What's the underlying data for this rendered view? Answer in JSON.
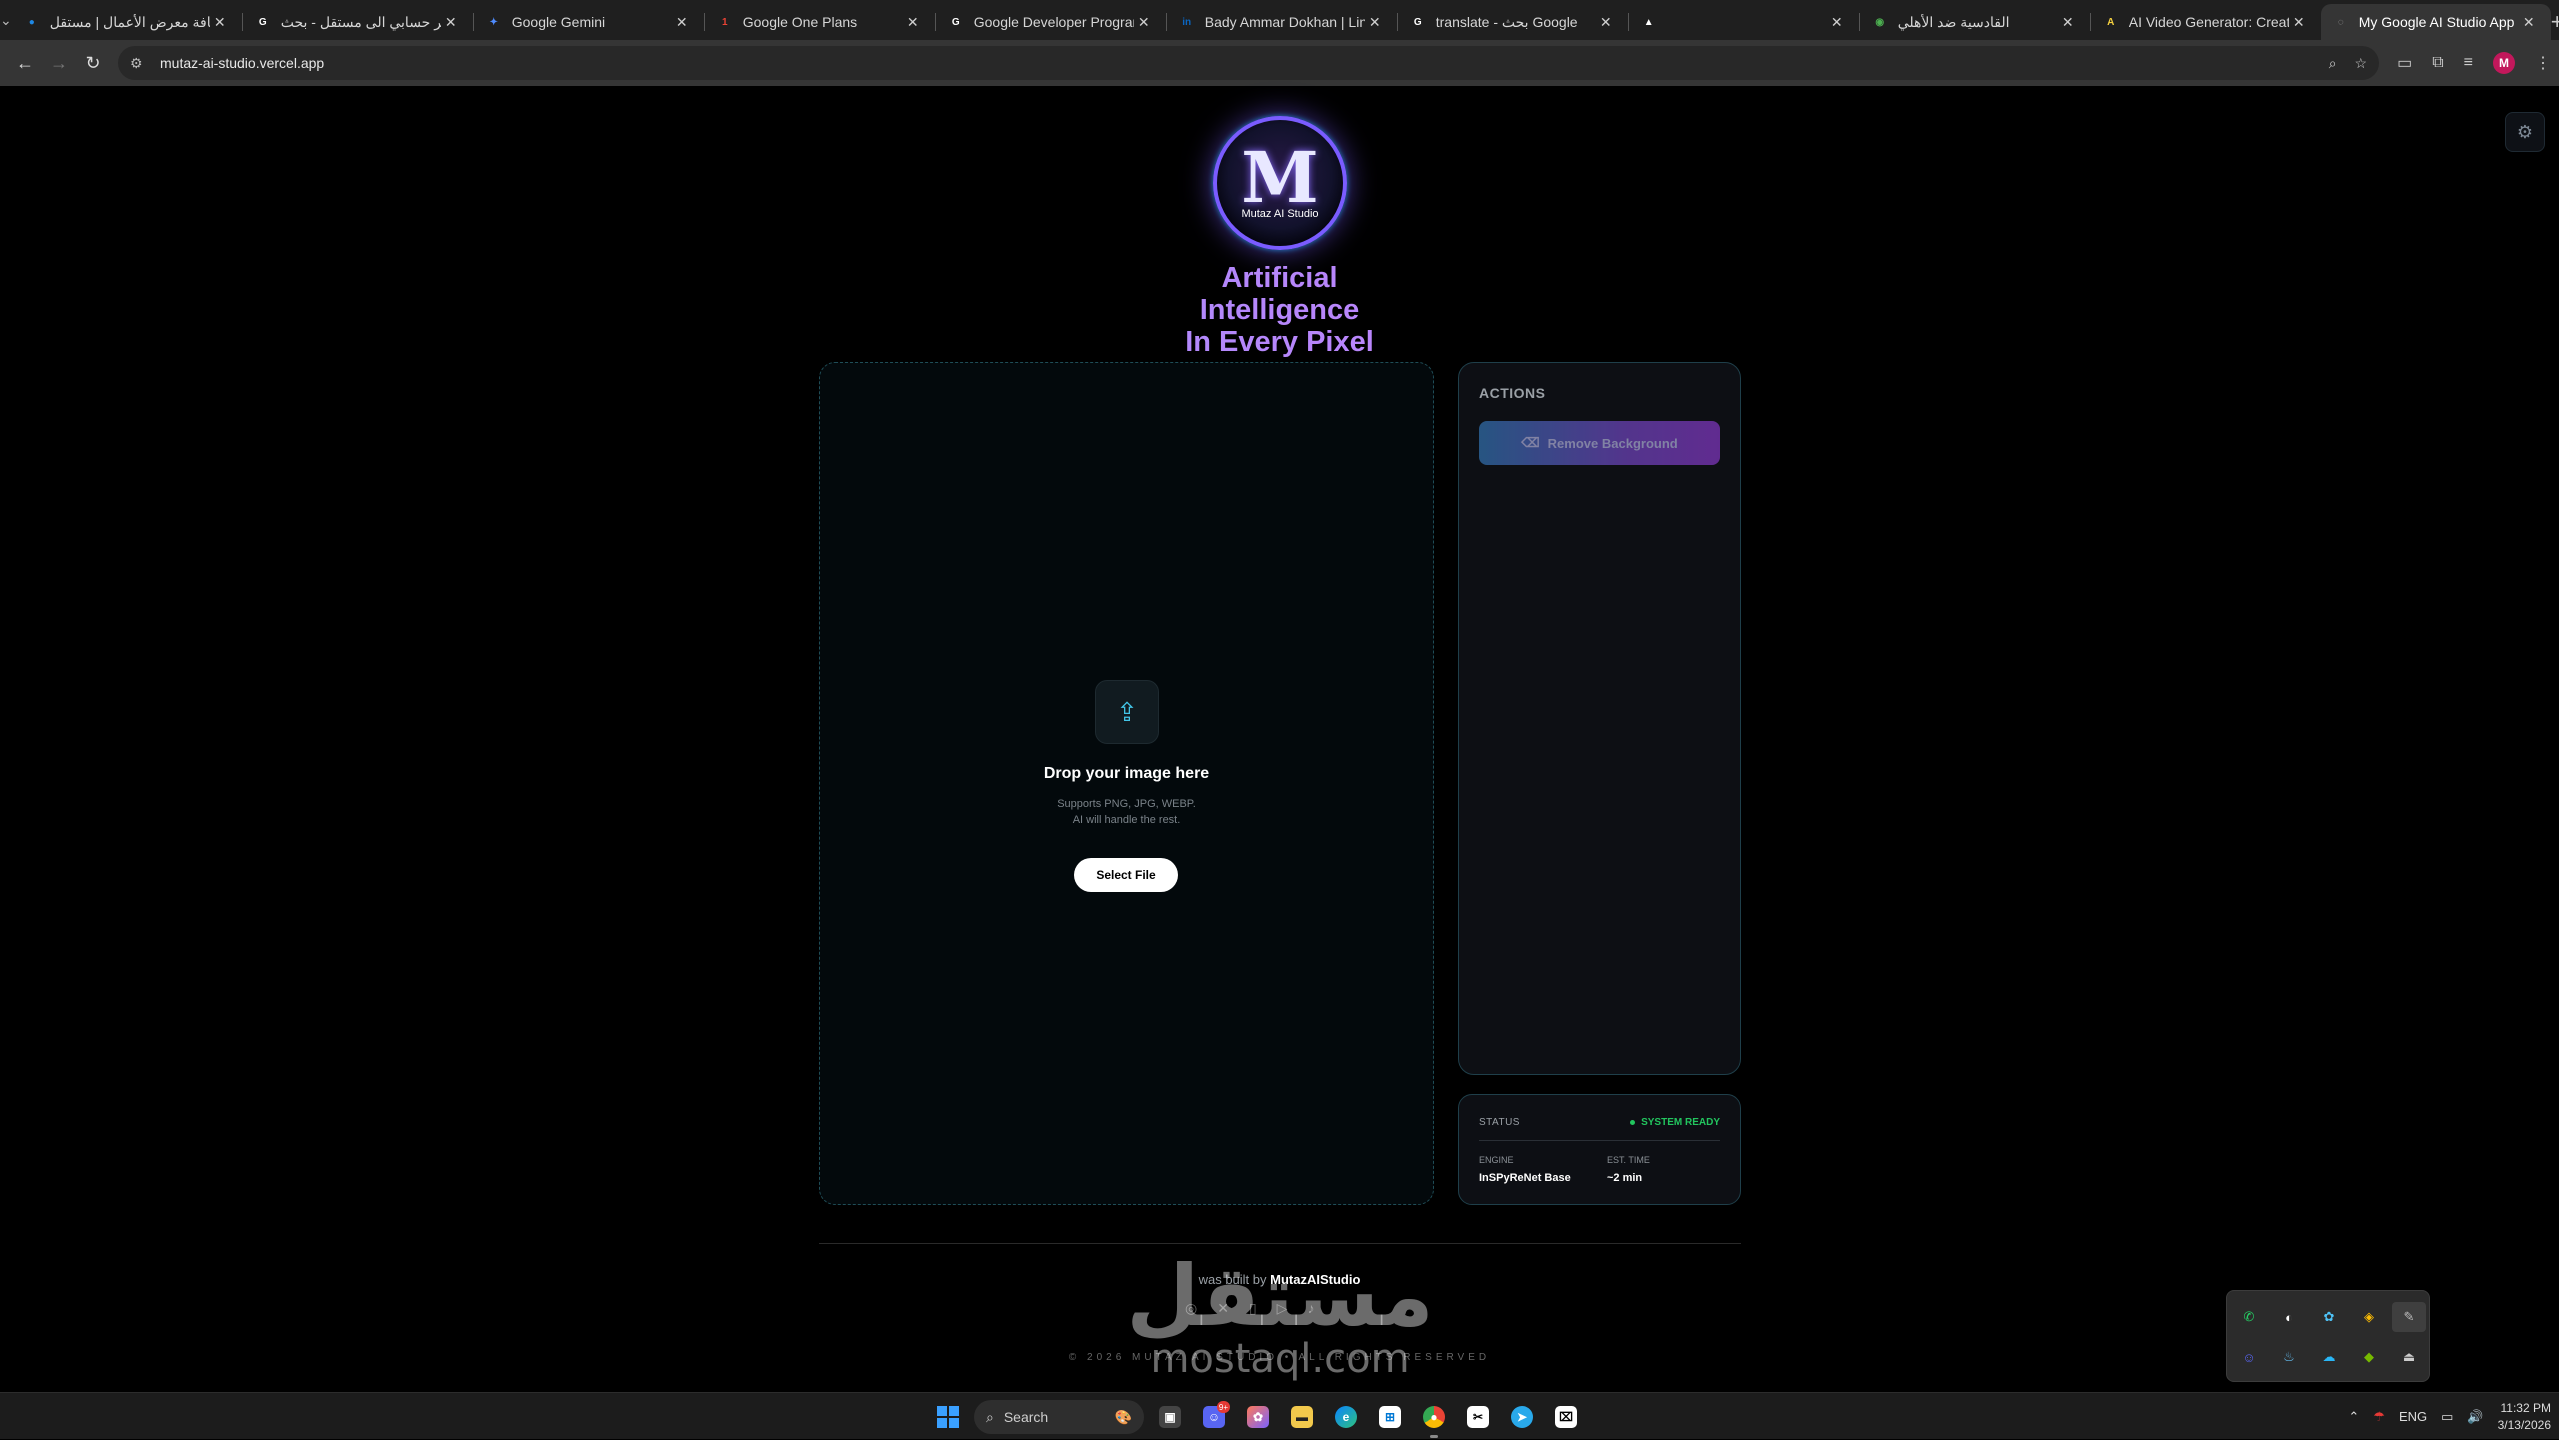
{
  "browser": {
    "tabs": [
      {
        "title": "إضافة معرض الأعمال | مستقل",
        "fav_color": "#1e88e5",
        "fav_glyph": "●"
      },
      {
        "title": "تغيير حسابي الى مستقل - بحث",
        "fav_color": "#ffffff",
        "fav_glyph": "G"
      },
      {
        "title": "Google Gemini",
        "fav_color": "#4f8cff",
        "fav_glyph": "✦"
      },
      {
        "title": "Google One Plans",
        "fav_color": "#ea4335",
        "fav_glyph": "1"
      },
      {
        "title": "Google Developer Program p",
        "fav_color": "#ffffff",
        "fav_glyph": "G"
      },
      {
        "title": "Bady Ammar Dokhan | LinkedI",
        "fav_color": "#0a66c2",
        "fav_glyph": "in"
      },
      {
        "title": "translate - بحث Google",
        "fav_color": "#ffffff",
        "fav_glyph": "G"
      },
      {
        "title": "",
        "fav_color": "#ffffff",
        "fav_glyph": "▲"
      },
      {
        "title": "القادسية ضد الأهلي",
        "fav_color": "#4caf50",
        "fav_glyph": "◉"
      },
      {
        "title": "AI Video Generator: Create st",
        "fav_color": "#f4d03f",
        "fav_glyph": "A"
      },
      {
        "title": "My Google AI Studio App",
        "fav_color": "#9e9e9e",
        "fav_glyph": "◌"
      }
    ],
    "url": "mutaz-ai-studio.vercel.app",
    "profile_initial": "M"
  },
  "app": {
    "logo_text": "Mutaz AI Studio",
    "logo_letter": "M",
    "hero_line1": "Artificial Intelligence",
    "hero_line2": "In Every Pixel",
    "dropzone": {
      "title": "Drop your image here",
      "sub1": "Supports PNG, JPG, WEBP.",
      "sub2": "AI will handle the rest.",
      "button": "Select File"
    },
    "actions": {
      "title": "ACTIONS",
      "remove_bg": "Remove Background"
    },
    "status": {
      "label": "STATUS",
      "state": "SYSTEM READY",
      "engine_label": "ENGINE",
      "engine_value": "InSPyReNet Base",
      "time_label": "EST. TIME",
      "time_value": "~2 min"
    },
    "footer": {
      "built_prefix": "was built by",
      "built_name": "MutazAIStudio",
      "copyright": "© 2026 MUTAZ AI STUDIO • ALL RIGHTS RESERVED"
    },
    "watermark": {
      "ar": "مستقل",
      "en": "mostaql.com"
    }
  },
  "taskbar": {
    "search_placeholder": "Search",
    "language": "ENG",
    "time": "11:32 PM",
    "date": "3/13/2026",
    "badge_count": "9+"
  }
}
